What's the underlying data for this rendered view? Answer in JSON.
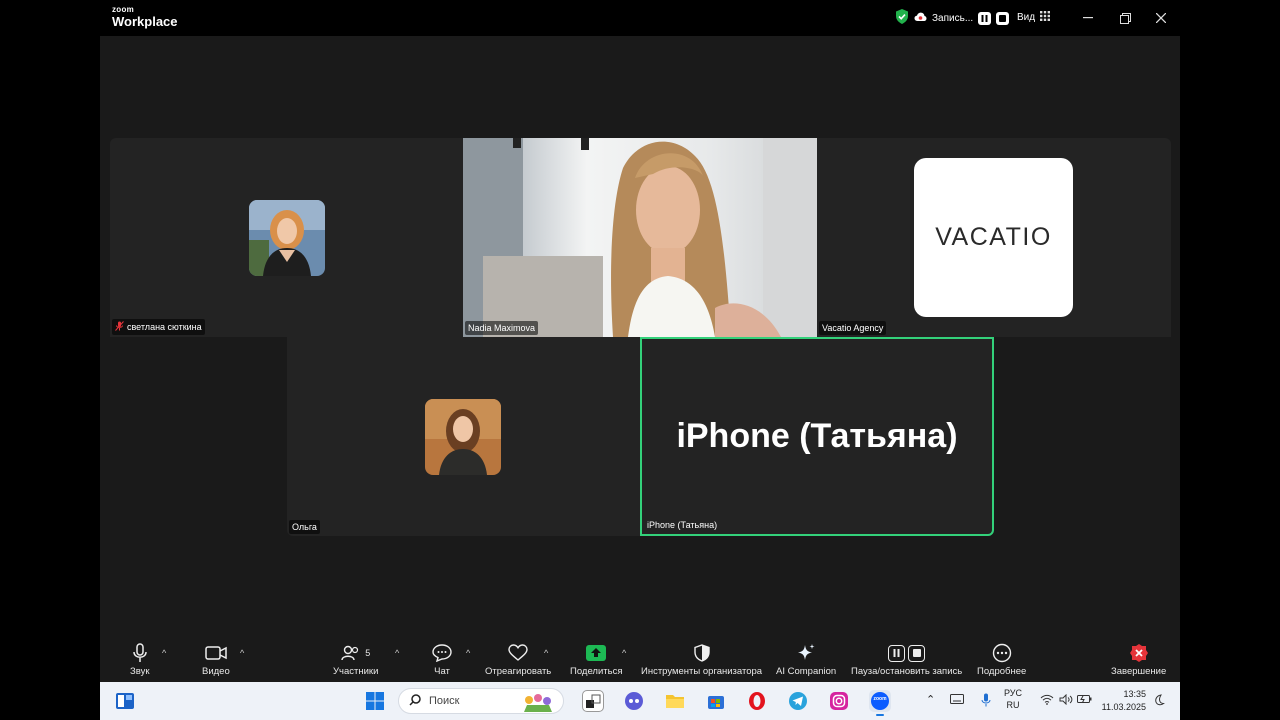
{
  "titlebar": {
    "brand_small": "zoom",
    "brand_large": "Workplace",
    "recording_label": "Запись...",
    "view_label": "Вид"
  },
  "tiles": [
    {
      "name": "светлана сюткина",
      "muted": true
    },
    {
      "name": "Nadia Maximova",
      "muted": false
    },
    {
      "name": "Vacatio Agency",
      "muted": false,
      "logo_text": "VACATIO"
    },
    {
      "name": "Ольга",
      "muted": false
    },
    {
      "name": "iPhone (Татьяна)",
      "muted": false,
      "big_label": "iPhone (Татьяна)",
      "active_speaker": true
    }
  ],
  "toolbar": {
    "audio": "Звук",
    "video": "Видео",
    "participants": "Участники",
    "participants_count": "5",
    "chat": "Чат",
    "react": "Отреагировать",
    "share": "Поделиться",
    "host_tools": "Инструменты организатора",
    "ai_companion": "AI Companion",
    "pause_stop_record": "Пауза/остановить запись",
    "more": "Подробнее",
    "end": "Завершение"
  },
  "taskbar": {
    "search_placeholder": "Поиск",
    "lang_top": "РУС",
    "lang_bottom": "RU",
    "time": "13:35",
    "date": "11.03.2025",
    "zoom_icon_text": "zoom"
  },
  "colors": {
    "active_speaker": "#33d17a",
    "share_green": "#1db954",
    "end_red": "#e5343a",
    "shield_green": "#22b24c"
  }
}
